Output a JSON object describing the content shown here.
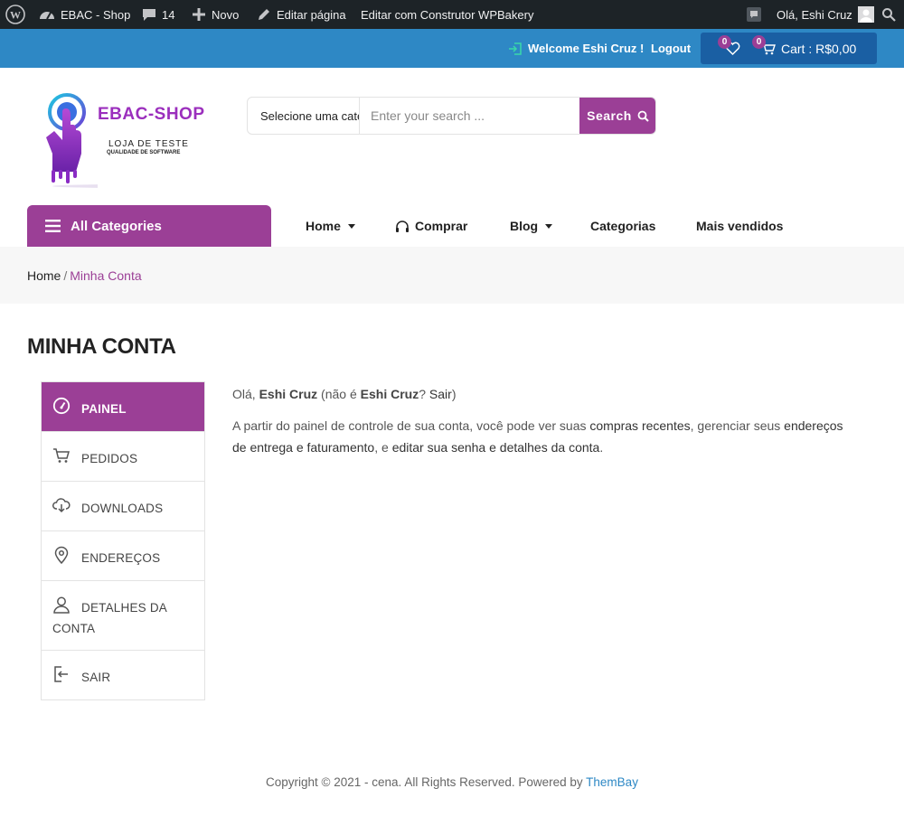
{
  "adminbar": {
    "site_name": "EBAC - Shop",
    "comments_count": "14",
    "new_label": "Novo",
    "edit_page": "Editar página",
    "edit_wpbakery": "Editar com Construtor WPBakery",
    "greeting": "Olá, Eshi Cruz"
  },
  "topbar": {
    "welcome": "Welcome Eshi Cruz !",
    "logout": "Logout",
    "wishlist_count": "0",
    "cart_count": "0",
    "cart_label": "Cart : R$0,00"
  },
  "logo": {
    "brand": "EBAC-SHOP",
    "line1": "LOJA DE TESTE",
    "line2": "QUALIDADE DE SOFTWARE"
  },
  "search": {
    "category": "Selecione uma categoria",
    "placeholder": "Enter your search ...",
    "button": "Search"
  },
  "nav": {
    "all_categories": "All Categories",
    "items": [
      {
        "label": "Home"
      },
      {
        "label": "Comprar"
      },
      {
        "label": "Blog"
      },
      {
        "label": "Categorias"
      },
      {
        "label": "Mais vendidos"
      }
    ]
  },
  "breadcrumb": {
    "home": "Home",
    "separator": "/",
    "current": "Minha Conta"
  },
  "page_title": "MINHA CONTA",
  "account_nav": [
    {
      "label": "PAINEL",
      "icon": "dashboard-icon",
      "active": true
    },
    {
      "label": "PEDIDOS",
      "icon": "cart-icon"
    },
    {
      "label": "DOWNLOADS",
      "icon": "cloud-download-icon"
    },
    {
      "label": "ENDEREÇOS",
      "icon": "location-pin-icon"
    },
    {
      "label": "DETALHES DA CONTA",
      "icon": "user-icon"
    },
    {
      "label": "SAIR",
      "icon": "logout-icon"
    }
  ],
  "content": {
    "hello": "Olá,",
    "user": "Eshi Cruz",
    "not_prefix": "(não é",
    "user2": "Eshi Cruz",
    "question": "?",
    "logout_link": "Sair",
    "close_paren": ")",
    "p2_a": "A partir do painel de controle de sua conta, você pode ver suas",
    "recent_orders": "compras recentes",
    "p2_b": ", gerenciar seus",
    "addresses": "endereços de entrega e faturamento",
    "p2_c": ", e",
    "edit_account": "editar sua senha e detalhes da conta",
    "p2_d": "."
  },
  "footer": {
    "text": "Copyright © 2021 - cena. All Rights Reserved. Powered by",
    "link": "ThemBay"
  },
  "colors": {
    "accent": "#9b3f96",
    "topbar": "#2e88c5",
    "cart_box": "#1a5fa3",
    "adminbar": "#1d2327"
  }
}
